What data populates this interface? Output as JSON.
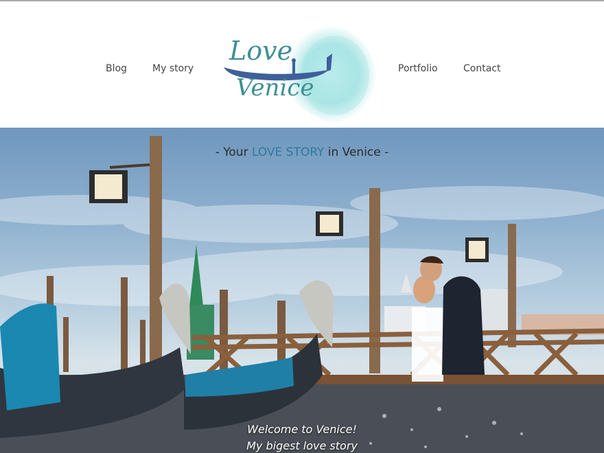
{
  "nav": {
    "left": [
      "Blog",
      "My story"
    ],
    "right": [
      "Portfolio",
      "Contact"
    ]
  },
  "logo": {
    "line1": "Love",
    "line2": "Venice",
    "ink_color": "#3e8f93",
    "splash_color": "#7fd6d9"
  },
  "hero": {
    "tagline_prefix": "- Your ",
    "tagline_highlight": "LOVE STORY",
    "tagline_suffix": " in Venice -",
    "highlight_color": "#2b7a9b",
    "welcome_line1": "Welcome to Venice!",
    "welcome_line2": "My bigest love story"
  }
}
